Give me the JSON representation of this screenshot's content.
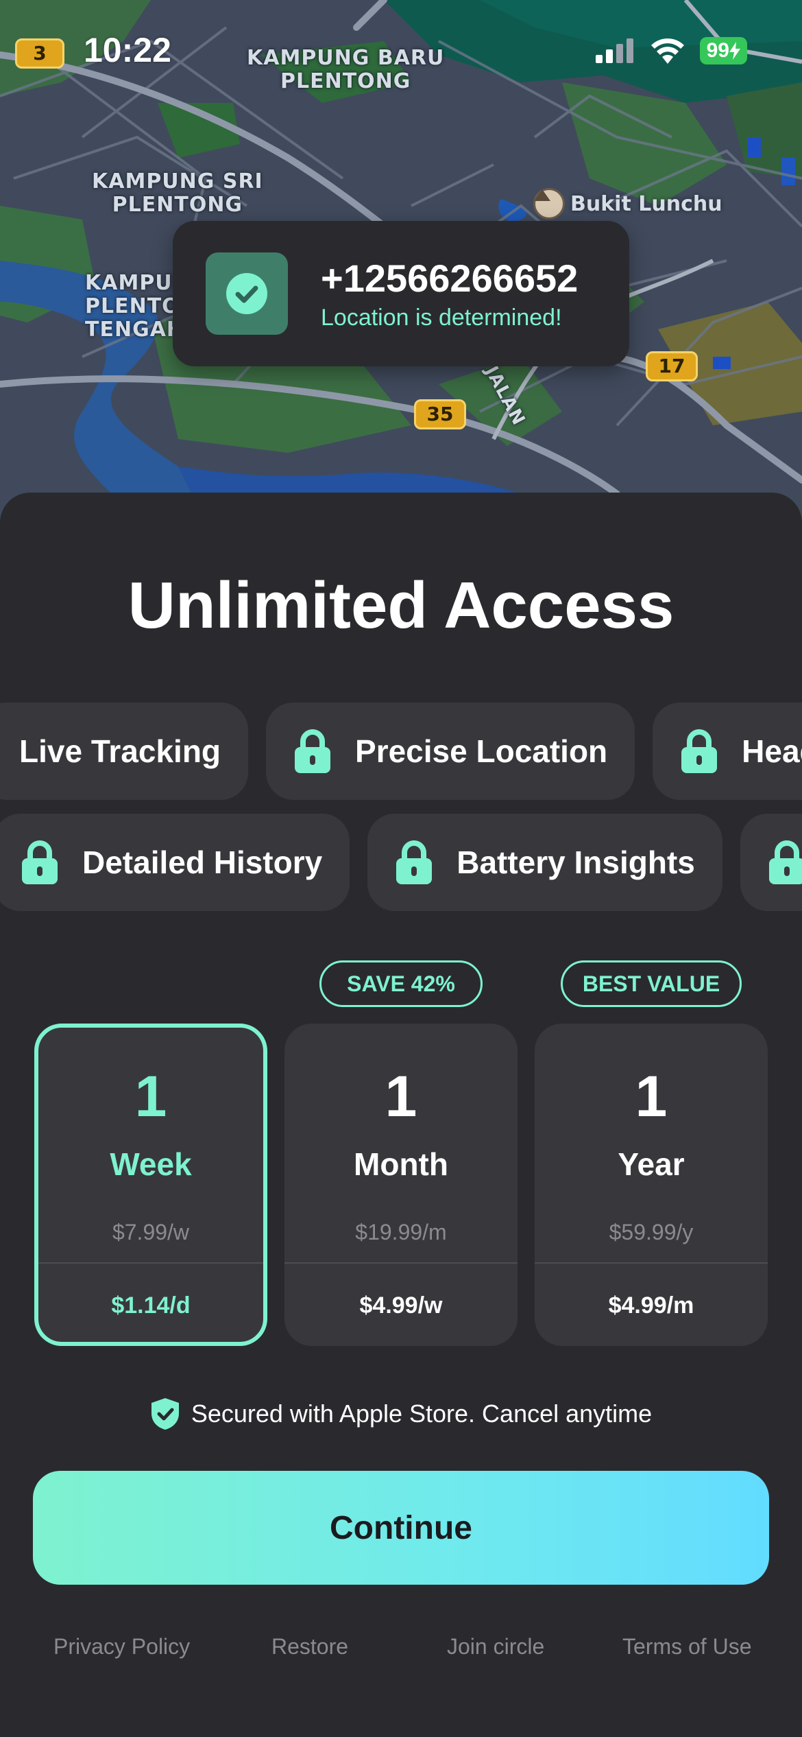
{
  "status_bar": {
    "time": "10:22",
    "battery": "99",
    "colors": {
      "battery": "#35c759"
    }
  },
  "map": {
    "labels": {
      "kampung_baru": "KAMPUNG BARU\nPLENTONG",
      "kampung_sri": "KAMPUNG SRI\nPLENTONG",
      "kampung_tengah": "KAMPUN\nPLENTON\nTENGAH",
      "jalan": "JALAN"
    },
    "poi": "Bukit Lunchu",
    "shields": {
      "s3": "3",
      "s17": "17",
      "s35": "35"
    }
  },
  "toast": {
    "phone": "+12566266652",
    "message": "Location is determined!",
    "icon": "check-icon"
  },
  "sheet": {
    "title": "Unlimited Access",
    "chips_row1": [
      {
        "label": "Live Tracking",
        "locked": false
      },
      {
        "label": "Precise Location",
        "locked": true
      },
      {
        "label": "Head",
        "locked": true
      }
    ],
    "chips_row2": [
      {
        "label": "Detailed History",
        "locked": true
      },
      {
        "label": "Battery Insights",
        "locked": true
      },
      {
        "label": "",
        "locked": true
      }
    ],
    "badges": {
      "month": "SAVE 42%",
      "year": "BEST VALUE"
    },
    "plans": [
      {
        "num": "1",
        "unit": "Week",
        "price": "$7.99/w",
        "per": "$1.14/d",
        "selected": true
      },
      {
        "num": "1",
        "unit": "Month",
        "price": "$19.99/m",
        "per": "$4.99/w",
        "selected": false
      },
      {
        "num": "1",
        "unit": "Year",
        "price": "$59.99/y",
        "per": "$4.99/m",
        "selected": false
      }
    ],
    "secured": "Secured with Apple Store. Cancel anytime",
    "continue": "Continue",
    "footer": {
      "privacy": "Privacy Policy",
      "restore": "Restore",
      "join": "Join circle",
      "terms": "Terms of Use"
    }
  },
  "colors": {
    "accent": "#7ef2cf",
    "sheet_bg": "#2a2a2e",
    "card_bg": "#38383c",
    "button_gradient_end": "#62dcff"
  }
}
